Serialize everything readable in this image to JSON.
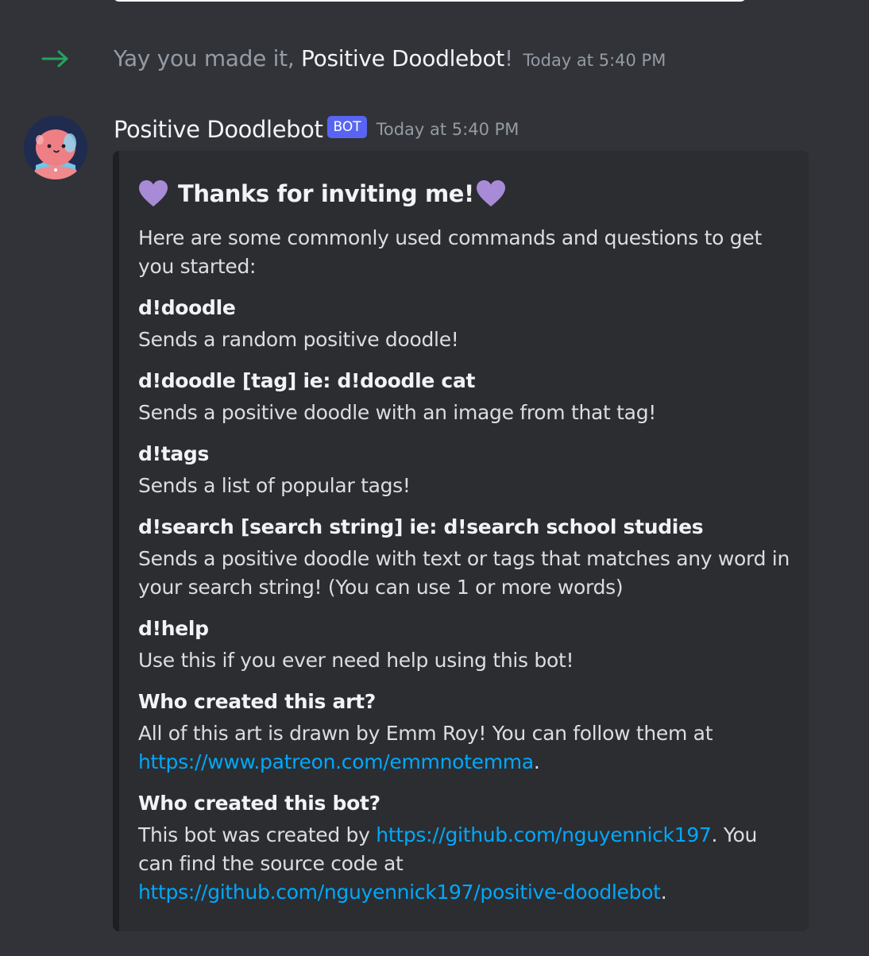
{
  "join": {
    "prefix": "Yay you made it, ",
    "name": "Positive Doodlebot",
    "suffix": "!",
    "time": "Today at 5:40 PM"
  },
  "message": {
    "author": "Positive Doodlebot",
    "tag": "BOT",
    "time": "Today at 5:40 PM"
  },
  "embed": {
    "title": "Thanks for inviting me!",
    "description": "Here are some commonly used commands and questions to get you started:",
    "fields": [
      {
        "name": "d!doodle",
        "value": "Sends a random positive doodle!"
      },
      {
        "name": "d!doodle [tag] ie: d!doodle cat",
        "value": "Sends a positive doodle with an image from that tag!"
      },
      {
        "name": "d!tags",
        "value": "Sends a list of popular tags!"
      },
      {
        "name": "d!search [search string] ie: d!search school studies",
        "value": "Sends a positive doodle with text or tags that matches any word in your search string! (You can use 1 or more words)"
      },
      {
        "name": "d!help",
        "value": "Use this if you ever need help using this bot!"
      }
    ],
    "art": {
      "name": "Who created this art?",
      "text": "All of this art is drawn by Emm Roy! You can follow them at ",
      "link": "https://www.patreon.com/emmnotemma",
      "end": "."
    },
    "bot": {
      "name": "Who created this bot?",
      "text1": "This bot was created by ",
      "link1": "https://github.com/nguyennick197",
      "text2": ". You can find the source code at ",
      "link2": "https://github.com/nguyennick197/positive-doodlebot",
      "end": "."
    }
  },
  "colors": {
    "background": "#313338",
    "embed": "#2b2d31",
    "link": "#00a8fc",
    "bot_tag": "#5865f2",
    "join_arrow": "#23a55a",
    "heart": "#a78bd7"
  },
  "icons": {
    "join": "arrow-right-icon",
    "heart": "purple-heart-icon"
  }
}
